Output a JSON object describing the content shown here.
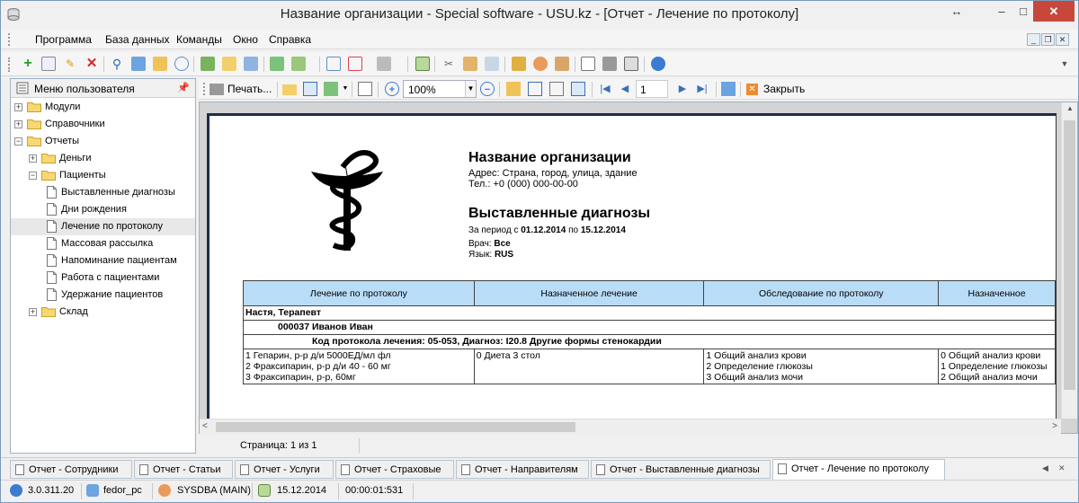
{
  "window": {
    "title": "Название организации - Special software - USU.kz - [Отчет - Лечение по протоколу]",
    "resize_icon": "↔",
    "min_icon": "‒",
    "max_icon": "□",
    "close_icon": "✕"
  },
  "menu": {
    "items": [
      "Программа",
      "База данных",
      "Команды",
      "Окно",
      "Справка"
    ]
  },
  "sidebar": {
    "header": "Меню пользователя",
    "tree": [
      {
        "label": "Модули",
        "level": 0,
        "type": "folder",
        "expander": "+"
      },
      {
        "label": "Справочники",
        "level": 0,
        "type": "folder",
        "expander": "+"
      },
      {
        "label": "Отчеты",
        "level": 0,
        "type": "folder",
        "expander": "−"
      },
      {
        "label": "Деньги",
        "level": 1,
        "type": "folder",
        "expander": "+"
      },
      {
        "label": "Пациенты",
        "level": 1,
        "type": "folder",
        "expander": "−"
      },
      {
        "label": "Выставленные диагнозы",
        "level": 2,
        "type": "doc"
      },
      {
        "label": "Дни рождения",
        "level": 2,
        "type": "doc"
      },
      {
        "label": "Лечение по протоколу",
        "level": 2,
        "type": "doc",
        "selected": true
      },
      {
        "label": "Массовая рассылка",
        "level": 2,
        "type": "doc"
      },
      {
        "label": "Напоминание пациентам",
        "level": 2,
        "type": "doc"
      },
      {
        "label": "Работа с пациентами",
        "level": 2,
        "type": "doc"
      },
      {
        "label": "Удержание пациентов",
        "level": 2,
        "type": "doc"
      },
      {
        "label": "Склад",
        "level": 1,
        "type": "folder",
        "expander": "+"
      }
    ]
  },
  "report_toolbar": {
    "print_label": "Печать...",
    "zoom_value": "100%",
    "page_number": "1",
    "close_label": "Закрыть"
  },
  "report": {
    "org_name": "Название организации",
    "address": "Адрес: Страна, город, улица, здание",
    "phone": "Тел.: +0 (000) 000-00-00",
    "title": "Выставленные диагнозы",
    "period_prefix": "За период с ",
    "period_from": "01.12.2014",
    "period_mid": " по ",
    "period_to": "15.12.2014",
    "doctor_prefix": "Врач: ",
    "doctor_value": "Все",
    "lang_prefix": "Язык: ",
    "lang_value": "RUS",
    "columns": [
      "Лечение по протоколу",
      "Назначенное лечение",
      "Обследование по протоколу",
      "Назначенное"
    ],
    "group_doctor": "Настя, Терапевт",
    "group_patient": "000037 Иванов Иван",
    "group_protocol": "Код протокола лечения: 05-053, Диагноз: I20.8 Другие формы стенокардии",
    "row": {
      "col1": [
        "1 Гепарин, р-р д/и 5000ЕД/мл фл",
        "2 Фраксипарин, р-р д/и 40 - 60 мг",
        "3 Фраксипарин, р-р, 60мг"
      ],
      "col2": [
        "0 Диета 3 стол"
      ],
      "col3": [
        "1 Общий анализ крови",
        "2 Определение глюкозы",
        "3 Общий анализ мочи"
      ],
      "col4": [
        "0 Общий анализ крови",
        "1 Определение глюкозы",
        "2 Общий анализ мочи"
      ]
    }
  },
  "page_status": "Страница:  1 из 1",
  "tabs": [
    {
      "label": "Отчет - Сотрудники"
    },
    {
      "label": "Отчет - Статьи"
    },
    {
      "label": "Отчет - Услуги"
    },
    {
      "label": "Отчет - Страховые"
    },
    {
      "label": "Отчет - Направителям"
    },
    {
      "label": "Отчет - Выставленные диагнозы"
    },
    {
      "label": "Отчет - Лечение по протоколу",
      "active": true
    }
  ],
  "statusbar": {
    "version": "3.0.311.20",
    "computer": "fedor_pc",
    "user": "SYSDBA (MAIN)",
    "date": "15.12.2014",
    "timer": "00:00:01:531"
  }
}
